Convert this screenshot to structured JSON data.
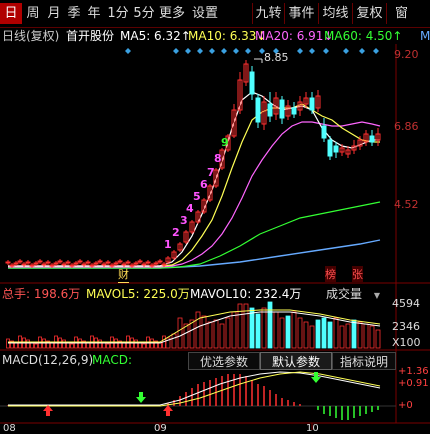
{
  "toolbar": {
    "tabs": [
      "日",
      "周",
      "月",
      "季",
      "年",
      "1分",
      "5分",
      "更多",
      "设置"
    ],
    "right_tabs": [
      "九转",
      "事件",
      "均线",
      "复权",
      "窗"
    ]
  },
  "info": {
    "period": "日线(复权)",
    "stock": "首开股份",
    "ma5": "MA5: 6.32↑",
    "ma10": "MA10: 6.33↓",
    "ma20": "MA20: 6.91↓",
    "ma60": "MA60: 4.50↑",
    "more": "M"
  },
  "price_axis": [
    "9.20",
    "6.86",
    "4.52"
  ],
  "high_label": "8.85",
  "markers": [
    "财",
    "榜",
    "张"
  ],
  "nine_turn": [
    "1",
    "2",
    "3",
    "4",
    "5",
    "6",
    "7",
    "8",
    "9"
  ],
  "volume": {
    "total": "总手: 198.6万",
    "mavol5": "MAVOL5: 225.0万",
    "mavol10": "MAVOL10: 232.4万",
    "dropdown": "成交量",
    "axis": [
      "4594",
      "2346",
      "X100"
    ]
  },
  "macd": {
    "label": "MACD(12,26,9)",
    "label2": "MACD:",
    "buttons": [
      "优选参数",
      "默认参数",
      "指标说明"
    ],
    "axis": [
      "+1.36",
      "+0.91",
      "+0"
    ]
  },
  "x_axis": [
    "08",
    "09",
    "10"
  ],
  "colors": {
    "up": "#ff3030",
    "down": "#50ffff",
    "ma5": "#ffffff",
    "ma10": "#ffff55",
    "ma20": "#ff66ff",
    "ma60": "#33ff33",
    "ma120": "#66aaff"
  }
}
